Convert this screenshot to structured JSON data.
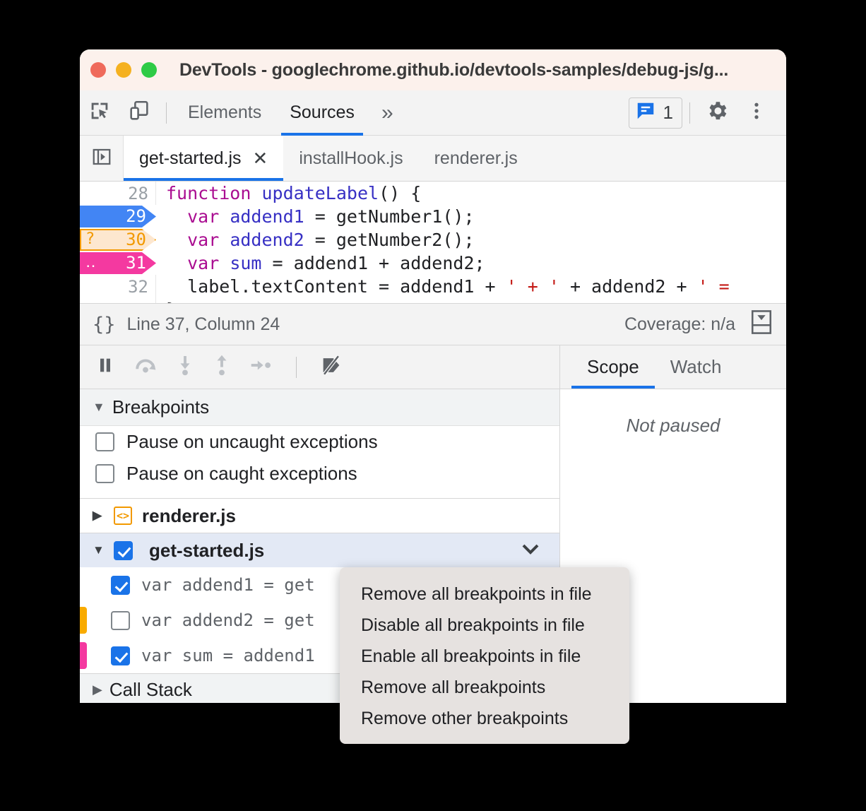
{
  "window": {
    "title": "DevTools - googlechrome.github.io/devtools-samples/debug-js/g...",
    "traffic_lights": [
      "close",
      "minimize",
      "maximize"
    ]
  },
  "toolbar": {
    "inspect_icon": "inspect-element-icon",
    "device_icon": "device-toolbar-icon",
    "panels": [
      {
        "label": "Elements",
        "active": false
      },
      {
        "label": "Sources",
        "active": true
      }
    ],
    "more_panels_label": "»",
    "messages_count": "1",
    "messages_icon": "console-message-icon",
    "settings_icon": "gear-icon",
    "more_icon": "kebab-menu-icon"
  },
  "file_tabs": {
    "navigator_icon": "show-navigator-icon",
    "tabs": [
      {
        "label": "get-started.js",
        "active": true,
        "closable": true,
        "close_glyph": "✕"
      },
      {
        "label": "installHook.js",
        "active": false,
        "closable": false
      },
      {
        "label": "renderer.js",
        "active": false,
        "closable": false
      }
    ]
  },
  "editor": {
    "lines": [
      {
        "num": "28",
        "marker": "none",
        "text": "function updateLabel() {"
      },
      {
        "num": "29",
        "marker": "breakpoint",
        "glyph": "",
        "text": "  var addend1 = getNumber1();"
      },
      {
        "num": "30",
        "marker": "conditional",
        "glyph": "?",
        "text": "  var addend2 = getNumber2();"
      },
      {
        "num": "31",
        "marker": "logpoint",
        "glyph": "‥",
        "text": "  var sum = addend1 + addend2;"
      },
      {
        "num": "32",
        "marker": "none",
        "text": "  label.textContent = addend1 + ' + ' + addend2 + ' ="
      }
    ]
  },
  "status_bar": {
    "pretty_print_icon": "format-braces-icon",
    "position": "Line 37, Column 24",
    "coverage": "Coverage: n/a",
    "drawer_icon": "show-drawer-icon"
  },
  "debugger_toolbar": {
    "buttons": [
      {
        "name": "resume-pause-button",
        "icon": "pause-icon"
      },
      {
        "name": "step-over-button",
        "icon": "step-over-icon"
      },
      {
        "name": "step-into-button",
        "icon": "step-into-icon"
      },
      {
        "name": "step-out-button",
        "icon": "step-out-icon"
      },
      {
        "name": "step-button",
        "icon": "step-icon"
      },
      {
        "name": "deactivate-breakpoints-button",
        "icon": "deactivate-breakpoints-icon"
      }
    ]
  },
  "breakpoints_pane": {
    "header": "Breakpoints",
    "header_triangle": "▼",
    "highlighted": true,
    "highlight_color": "#1656e8",
    "pause_options": [
      {
        "label": "Pause on uncaught exceptions",
        "checked": false
      },
      {
        "label": "Pause on caught exceptions",
        "checked": false
      }
    ],
    "files": [
      {
        "name": "renderer.js",
        "expanded": false,
        "triangle": "▶",
        "checkbox": "none",
        "icon": "js-file-icon",
        "items": []
      },
      {
        "name": "get-started.js",
        "expanded": true,
        "triangle": "▼",
        "checkbox": "checked",
        "selected": true,
        "chevron_icon": "chevron-down-icon",
        "items": [
          {
            "label": "var addend1 = get",
            "checked": true,
            "edge": "none"
          },
          {
            "label": "var addend2 = get",
            "checked": false,
            "edge": "#f9ab00"
          },
          {
            "label": "var sum = addend1",
            "checked": true,
            "edge": "#f439a0"
          }
        ]
      }
    ],
    "call_stack_label": "Call Stack"
  },
  "side_pane": {
    "tabs": [
      {
        "label": "Scope",
        "active": true
      },
      {
        "label": "Watch",
        "active": false
      }
    ],
    "empty_message": "Not paused"
  },
  "context_menu": {
    "items": [
      "Remove all breakpoints in file",
      "Disable all breakpoints in file",
      "Enable all breakpoints in file",
      "Remove all breakpoints",
      "Remove other breakpoints"
    ]
  }
}
